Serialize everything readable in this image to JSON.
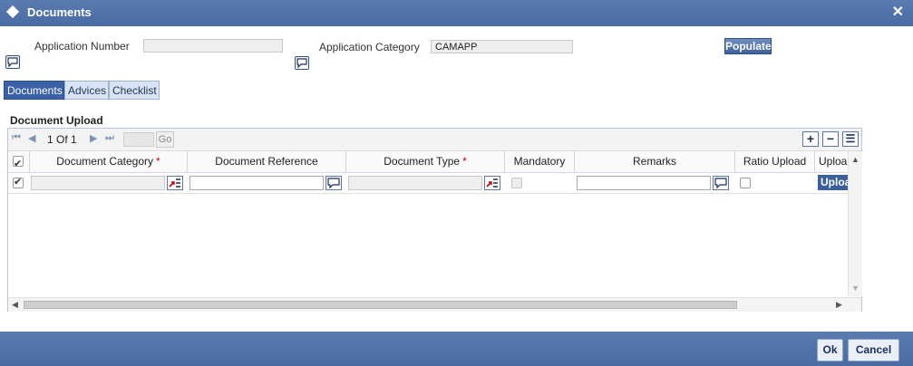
{
  "window": {
    "title": "Documents",
    "close_glyph": "✕"
  },
  "header": {
    "app_number_label": "Application Number",
    "app_number_value": "",
    "app_category_label": "Application Category",
    "app_category_value": "CAMAPP",
    "populate_label": "Populate"
  },
  "tabs": [
    {
      "label": "Documents",
      "active": true
    },
    {
      "label": "Advices",
      "active": false
    },
    {
      "label": "Checklist",
      "active": false
    }
  ],
  "section": {
    "title": "Document Upload"
  },
  "pager": {
    "first": "⏮",
    "prev": "◀",
    "page_text": "1 Of 1",
    "next": "▶",
    "last": "⏭",
    "go_label": "Go"
  },
  "grid_tools": {
    "add": "+",
    "remove": "−",
    "single_view": "☰"
  },
  "table": {
    "columns": [
      {
        "label": "Document Category",
        "required": true
      },
      {
        "label": "Document Reference",
        "required": false
      },
      {
        "label": "Document Type",
        "required": true
      },
      {
        "label": "Mandatory",
        "required": false
      },
      {
        "label": "Remarks",
        "required": false
      },
      {
        "label": "Ratio Upload",
        "required": false
      },
      {
        "label": "Uploa",
        "required": false
      }
    ],
    "required_mark": "*",
    "rows": [
      {
        "selected": true,
        "document_category": "",
        "document_reference": "",
        "document_type": "",
        "mandatory": false,
        "remarks": "",
        "ratio_upload": false,
        "upload_label": "Upload"
      }
    ]
  },
  "footer": {
    "ok_label": "Ok",
    "cancel_label": "Cancel"
  },
  "colors": {
    "titlebar": "#4a6aa3",
    "accent": "#3b62a8",
    "required": "#cc0000"
  }
}
